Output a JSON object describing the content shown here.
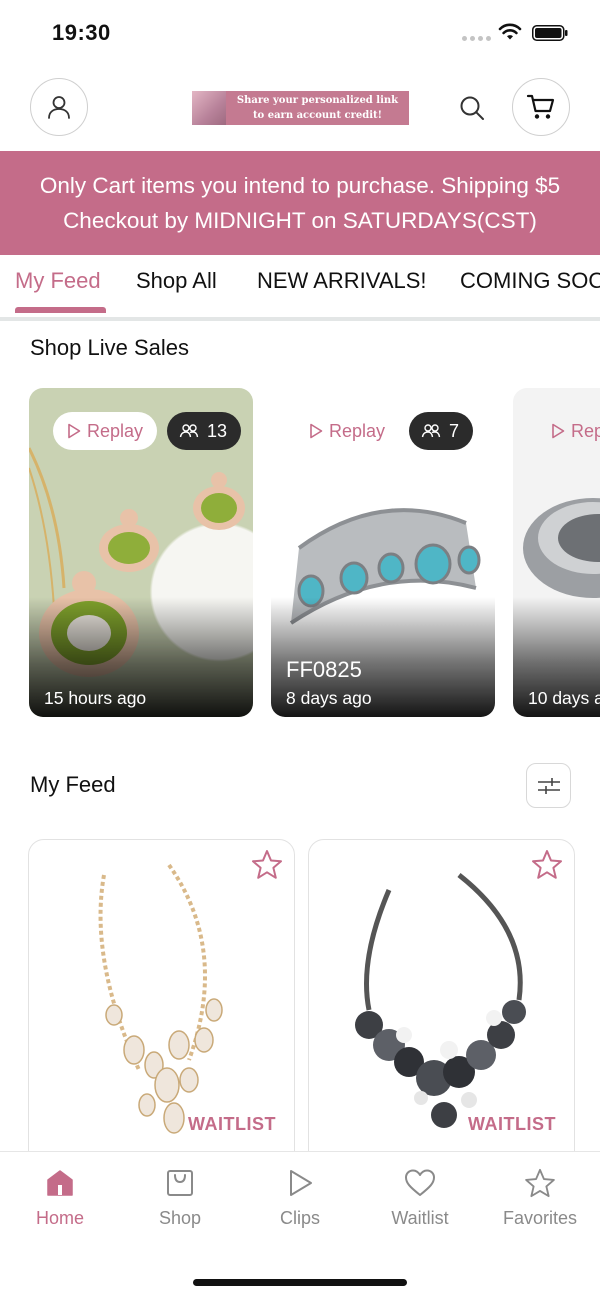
{
  "status_bar": {
    "time": "19:30"
  },
  "header": {
    "banner_text": "Share your personalized link to earn account credit!"
  },
  "announcement": {
    "line1": "Only Cart items you intend to purchase. Shipping $5",
    "line2": "Checkout by MIDNIGHT on SATURDAYS(CST)"
  },
  "tabs": [
    {
      "label": "My Feed",
      "active": true
    },
    {
      "label": "Shop All"
    },
    {
      "label": "NEW ARRIVALS!"
    },
    {
      "label": "COMING SOO"
    }
  ],
  "live_sales": {
    "title": "Shop Live Sales",
    "cards": [
      {
        "replay_label": "Replay",
        "viewers": "13",
        "title": "",
        "time": "15 hours ago"
      },
      {
        "replay_label": "Replay",
        "viewers": "7",
        "title": "FF0825",
        "time": "8 days ago"
      },
      {
        "replay_label": "Rep",
        "viewers": "",
        "title": "",
        "time": "10 days a"
      }
    ]
  },
  "feed": {
    "title": "My Feed",
    "products": [
      {
        "status": "WAITLIST"
      },
      {
        "status": "WAITLIST"
      }
    ]
  },
  "bottom_nav": [
    {
      "label": "Home",
      "icon": "home-icon",
      "active": true
    },
    {
      "label": "Shop",
      "icon": "shopping-bag-icon"
    },
    {
      "label": "Clips",
      "icon": "play-icon"
    },
    {
      "label": "Waitlist",
      "icon": "heart-icon"
    },
    {
      "label": "Favorites",
      "icon": "star-icon"
    }
  ],
  "colors": {
    "accent": "#c46c89",
    "announcement_bg": "#c46c89",
    "banner_bg": "#c47a91"
  }
}
